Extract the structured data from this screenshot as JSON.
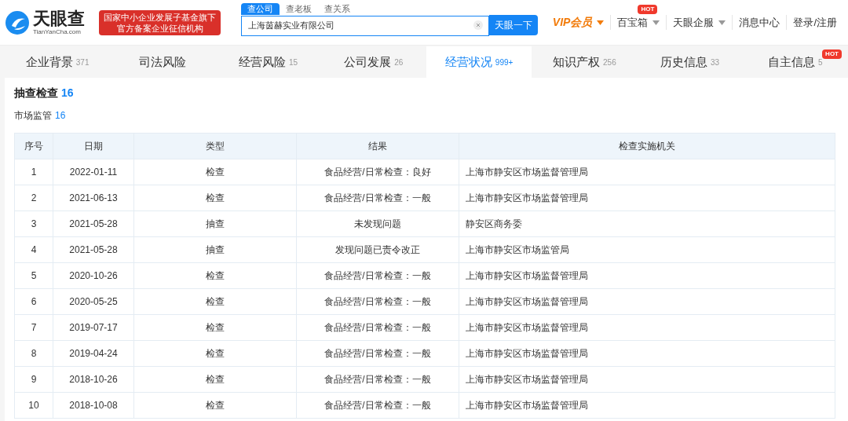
{
  "header": {
    "logo": {
      "name": "天眼查",
      "domain": "TianYanCha.com"
    },
    "banner": [
      "国家中小企业发展子基金旗下",
      "官方备案企业征信机构"
    ],
    "search": {
      "tabs": [
        {
          "label": "查公司",
          "selected": true
        },
        {
          "label": "查老板",
          "selected": false
        },
        {
          "label": "查关系",
          "selected": false
        }
      ],
      "value": "上海茵赫实业有限公司",
      "button": "天眼一下"
    },
    "nav": [
      {
        "label": "VIP会员",
        "kind": "vip",
        "dropdown": true
      },
      {
        "label": "百宝箱",
        "kind": "plain",
        "dropdown": true,
        "badge": "HOT"
      },
      {
        "label": "天眼企服",
        "kind": "plain",
        "dropdown": true
      },
      {
        "label": "消息中心",
        "kind": "plain",
        "dropdown": false
      },
      {
        "label": "登录/注册",
        "kind": "plain",
        "dropdown": false
      }
    ]
  },
  "tabs": [
    {
      "label": "企业背景",
      "count": "371",
      "selected": false
    },
    {
      "label": "司法风险",
      "selected": false
    },
    {
      "label": "经营风险",
      "count": "15",
      "selected": false
    },
    {
      "label": "公司发展",
      "count": "26",
      "selected": false
    },
    {
      "label": "经营状况",
      "count": "999+",
      "selected": true
    },
    {
      "label": "知识产权",
      "count": "256",
      "selected": false
    },
    {
      "label": "历史信息",
      "count": "33",
      "selected": false
    },
    {
      "label": "自主信息",
      "count": "5",
      "selected": false,
      "badge": "HOT"
    }
  ],
  "section": {
    "title": "抽查检查",
    "count": "16",
    "subtitle": "市场监管",
    "subcount": "16"
  },
  "table": {
    "columns": [
      "序号",
      "日期",
      "类型",
      "结果",
      "检查实施机关"
    ],
    "rows": [
      [
        "1",
        "2022-01-11",
        "检查",
        "食品经营/日常检查：良好",
        "上海市静安区市场监督管理局"
      ],
      [
        "2",
        "2021-06-13",
        "检查",
        "食品经营/日常检查：一般",
        "上海市静安区市场监督管理局"
      ],
      [
        "3",
        "2021-05-28",
        "抽查",
        "未发现问题",
        "静安区商务委"
      ],
      [
        "4",
        "2021-05-28",
        "抽查",
        "发现问题已责令改正",
        "上海市静安区市场监管局"
      ],
      [
        "5",
        "2020-10-26",
        "检查",
        "食品经营/日常检查：一般",
        "上海市静安区市场监督管理局"
      ],
      [
        "6",
        "2020-05-25",
        "检查",
        "食品经营/日常检查：一般",
        "上海市静安区市场监督管理局"
      ],
      [
        "7",
        "2019-07-17",
        "检查",
        "食品经营/日常检查：一般",
        "上海市静安区市场监督管理局"
      ],
      [
        "8",
        "2019-04-24",
        "检查",
        "食品经营/日常检查：一般",
        "上海市静安区市场监督管理局"
      ],
      [
        "9",
        "2018-10-26",
        "检查",
        "食品经营/日常检查：一般",
        "上海市静安区市场监督管理局"
      ],
      [
        "10",
        "2018-10-08",
        "检查",
        "食品经营/日常检查：一般",
        "上海市静安区市场监督管理局"
      ]
    ]
  }
}
